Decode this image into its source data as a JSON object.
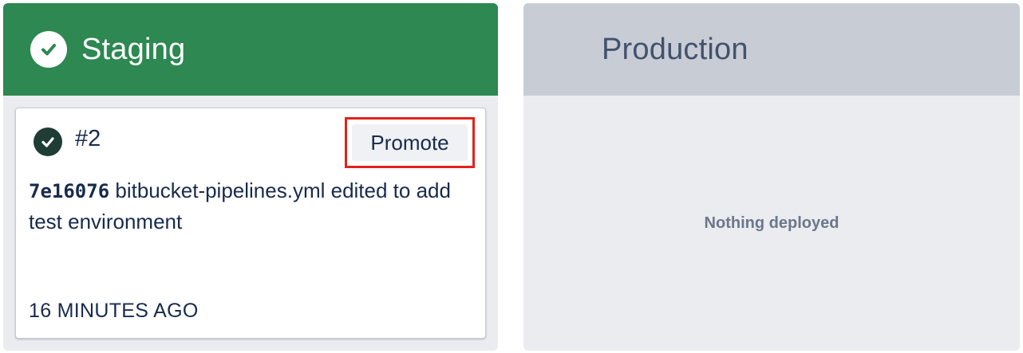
{
  "staging": {
    "title": "Staging",
    "status_icon": "check-circle-icon",
    "header_color": "#2d8851",
    "deployment": {
      "number": "#2",
      "status_icon": "check-circle-icon",
      "promote_label": "Promote",
      "commit_hash": "7e16076",
      "commit_message": " bitbucket-pipelines.yml edited to add test environment",
      "time": "16 MINUTES AGO"
    }
  },
  "production": {
    "title": "Production",
    "header_color": "#c8ccd5",
    "empty_message": "Nothing deployed"
  },
  "highlight_color": "#e0231c"
}
